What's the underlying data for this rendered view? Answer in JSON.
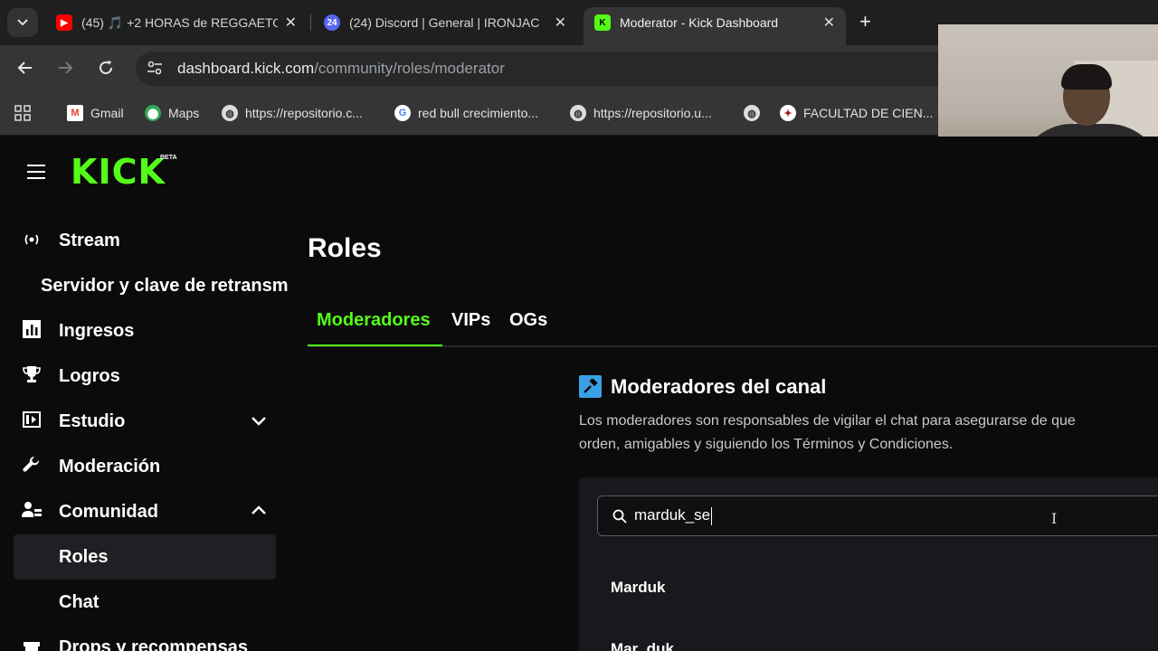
{
  "browser": {
    "tabs": [
      {
        "title": "(45) 🎵 +2 HORAS de REGGAETON",
        "favicon": "youtube-icon",
        "color": "#ff0000"
      },
      {
        "title": "(24) Discord | General | IRONJAC",
        "favicon": "discord-icon",
        "badge": "24",
        "color": "#5865f2"
      },
      {
        "title": "Moderator - Kick Dashboard",
        "favicon": "kick-icon",
        "color": "#53fc18"
      }
    ],
    "url_host": "dashboard.kick.com",
    "url_path": "/community/roles/moderator",
    "bookmarks": [
      {
        "label": "Gmail",
        "icon": "gmail-icon"
      },
      {
        "label": "Maps",
        "icon": "maps-icon"
      },
      {
        "label": "https://repositorio.c...",
        "icon": "globe-icon"
      },
      {
        "label": "red bull crecimiento...",
        "icon": "google-icon"
      },
      {
        "label": "https://repositorio.u...",
        "icon": "globe-icon"
      },
      {
        "label": "",
        "icon": "globe-icon"
      },
      {
        "label": "FACULTAD DE CIEN...",
        "icon": "university-icon"
      }
    ]
  },
  "brand": {
    "logo": "KICK",
    "badge": "BETA",
    "accent": "#53fc18"
  },
  "sidebar": {
    "items": [
      {
        "label": "Stream",
        "icon": "broadcast-icon"
      },
      {
        "label": "Servidor y clave de retransm",
        "icon": ""
      },
      {
        "label": "Ingresos",
        "icon": "chart-icon"
      },
      {
        "label": "Logros",
        "icon": "trophy-icon"
      },
      {
        "label": "Estudio",
        "icon": "studio-icon",
        "expand": "chevron-down-icon"
      },
      {
        "label": "Moderación",
        "icon": "wrench-icon"
      },
      {
        "label": "Comunidad",
        "icon": "users-icon",
        "expand": "chevron-up-icon"
      },
      {
        "label": "Roles",
        "icon": ""
      },
      {
        "label": "Chat",
        "icon": ""
      },
      {
        "label": "Drops y recompensas",
        "icon": "gift-icon"
      }
    ]
  },
  "main": {
    "title": "Roles",
    "tabs": [
      "Moderadores",
      "VIPs",
      "OGs"
    ],
    "section_title": "Moderadores del canal",
    "section_desc_1": "Los moderadores son responsables de vigilar el chat para asegurarse de que",
    "section_desc_2": "orden, amigables y siguiendo los Términos y Condiciones.",
    "search_value": "marduk_se",
    "results": [
      "Marduk",
      "Mar_duk"
    ]
  }
}
